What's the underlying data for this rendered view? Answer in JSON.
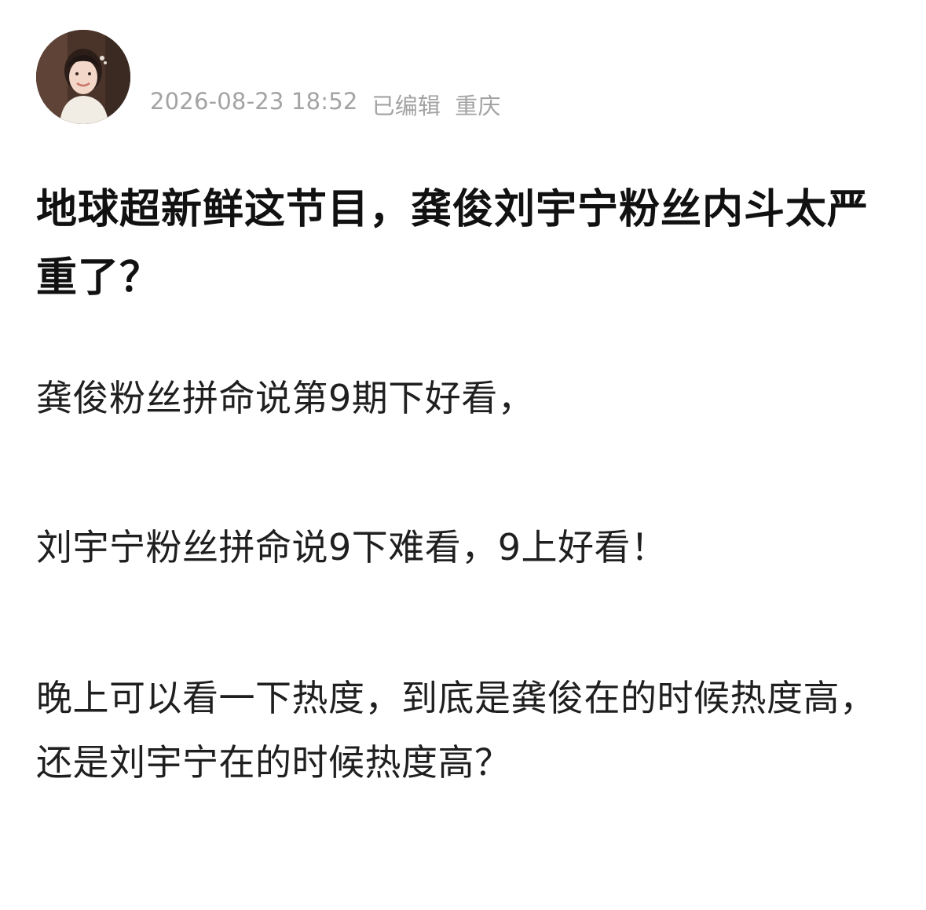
{
  "post": {
    "author": {
      "name": "",
      "avatar_icon": "avatar-photo"
    },
    "meta": {
      "timestamp": "2026-08-23 18:52",
      "edited": "已编辑",
      "location": "重庆"
    },
    "title": "地球超新鲜这节目，龚俊刘宇宁粉丝内斗太严重了？",
    "paragraphs": [
      "龚俊粉丝拼命说第9期下好看，",
      "刘宇宁粉丝拼命说9下难看，9上好看！",
      "晚上可以看一下热度，到底是龚俊在的时候热度高，还是刘宇宁在的时候热度高？"
    ]
  },
  "colors": {
    "background": "#ffffff",
    "text_primary": "#111111",
    "text_body": "#1f1f1f",
    "text_meta": "#a3a3a3"
  }
}
